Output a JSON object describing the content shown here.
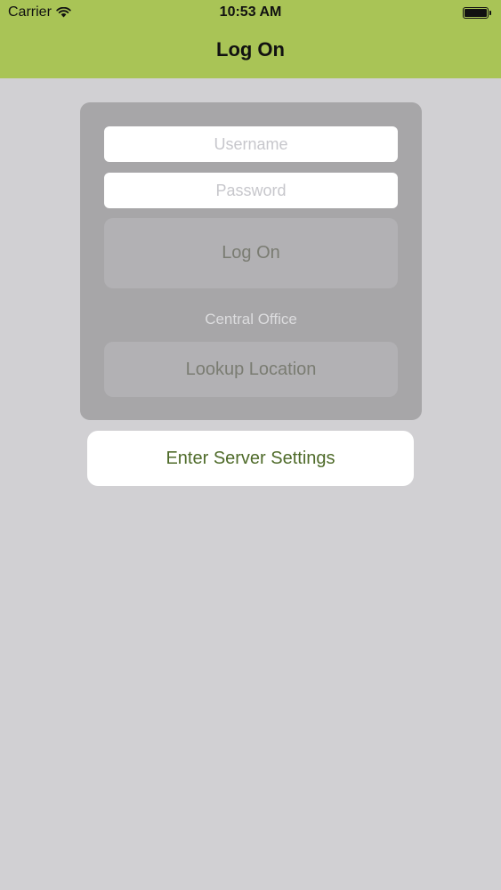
{
  "status_bar": {
    "carrier": "Carrier",
    "time": "10:53 AM",
    "wifi_icon": "wifi-icon",
    "battery_icon": "battery-full-icon"
  },
  "nav": {
    "title": "Log On"
  },
  "login_form": {
    "username_placeholder": "Username",
    "username_value": "",
    "password_placeholder": "Password",
    "password_value": "",
    "logon_label": "Log On",
    "location_label": "Central Office",
    "lookup_label": "Lookup Location"
  },
  "server_settings_label": "Enter Server Settings",
  "colors": {
    "nav_background": "#a9c456",
    "page_background": "#d1d0d3",
    "panel_background": "#a7a6a8",
    "disabled_button": "#b2b1b4",
    "server_button_text": "#4f6b2a"
  }
}
